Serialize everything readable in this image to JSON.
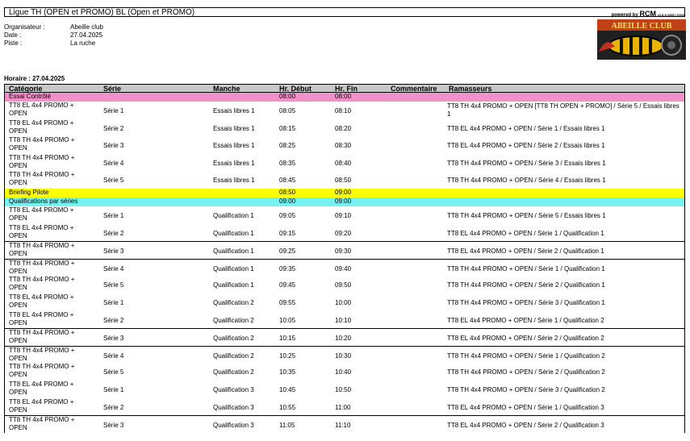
{
  "title": "Ligue TH (OPEN et PROMO) BL (Open et PROMO)",
  "powered": {
    "prefix": "powered by",
    "brand": "RCM",
    "version": "v2.8.5.1655 / 0204"
  },
  "meta": [
    {
      "key": "Organisateur :",
      "value": "Abeille club"
    },
    {
      "key": "Date :",
      "value": "27.04.2025"
    },
    {
      "key": "Piste :",
      "value": "La ruche"
    }
  ],
  "logo_text": "ABEILLE CLUB",
  "horaire": "Horaire : 27.04.2025",
  "columns": [
    "Catégorie",
    "Série",
    "Manche",
    "Hr. Début",
    "Hr. Fin",
    "Commentaire",
    "Ramasseurs"
  ],
  "colors": {
    "pink": "#f291c9",
    "yellow": "#ffff00",
    "cyan": "#77f2f0",
    "header": "#c8c8c8"
  },
  "rows": [
    {
      "kind": "band",
      "color": "pink",
      "cat": "Essai Contrôlé",
      "start": "08:00",
      "end": "08:00"
    },
    {
      "kind": "data",
      "cat": "TT8 EL 4x4 PROMO + OPEN",
      "serie": "Série 1",
      "manche": "Essais libres 1",
      "start": "08:05",
      "end": "08:10",
      "ram": "TT8 TH 4x4 PROMO + OPEN [TT8 TH OPEN + PROMO] / Série 5 / Essais libres 1",
      "wrap": true
    },
    {
      "kind": "data",
      "cat": "TT8 EL 4x4 PROMO + OPEN",
      "serie": "Série 2",
      "manche": "Essais libres 1",
      "start": "08:15",
      "end": "08:20",
      "ram": "TT8 EL 4x4 PROMO + OPEN / Série 1 / Essais libres 1"
    },
    {
      "kind": "data",
      "cat": "TT8 TH 4x4 PROMO + OPEN",
      "serie": "Série 3",
      "manche": "Essais libres 1",
      "start": "08:25",
      "end": "08:30",
      "ram": "TT8 EL 4x4 PROMO + OPEN / Série 2 / Essais libres 1"
    },
    {
      "kind": "data",
      "cat": "TT8 TH 4x4 PROMO + OPEN",
      "serie": "Série 4",
      "manche": "Essais libres 1",
      "start": "08:35",
      "end": "08:40",
      "ram": "TT8 TH 4x4 PROMO + OPEN / Série 3 / Essais libres 1"
    },
    {
      "kind": "data",
      "cat": "TT8 TH 4x4 PROMO + OPEN",
      "serie": "Série 5",
      "manche": "Essais libres 1",
      "start": "08:45",
      "end": "08:50",
      "ram": "TT8 TH 4x4 PROMO + OPEN / Série 4 / Essais libres 1"
    },
    {
      "kind": "band",
      "color": "yellow",
      "cat": "Briefing Pilote",
      "start": "08:50",
      "end": "09:00"
    },
    {
      "kind": "band",
      "color": "cyan",
      "cat": "Qualifications par séries",
      "start": "09:00",
      "end": "09:00"
    },
    {
      "kind": "data",
      "cat": "TT8 EL 4x4 PROMO + OPEN",
      "serie": "Série 1",
      "manche": "Qualification 1",
      "start": "09:05",
      "end": "09:10",
      "ram": "TT8 TH 4x4 PROMO + OPEN / Série 5 / Essais libres 1"
    },
    {
      "kind": "data",
      "cat": "TT8 EL 4x4 PROMO + OPEN",
      "serie": "Série 2",
      "manche": "Qualification 1",
      "start": "09:15",
      "end": "09:20",
      "ram": "TT8 EL 4x4 PROMO + OPEN / Série 1 / Qualification 1"
    },
    {
      "kind": "data",
      "cat": "TT8 TH 4x4 PROMO + OPEN",
      "serie": "Série 3",
      "manche": "Qualification 1",
      "start": "09:25",
      "end": "09:30",
      "ram": "TT8 EL 4x4 PROMO + OPEN / Série 2 / Qualification 1",
      "sep": true
    },
    {
      "kind": "data",
      "cat": "TT8 TH 4x4 PROMO + OPEN",
      "serie": "Série 4",
      "manche": "Qualification 1",
      "start": "09:35",
      "end": "09:40",
      "ram": "TT8 TH 4x4 PROMO + OPEN / Série 1 / Qualification 1",
      "sep": true
    },
    {
      "kind": "data",
      "cat": "TT8 TH 4x4 PROMO + OPEN",
      "serie": "Série 5",
      "manche": "Qualification 1",
      "start": "09:45",
      "end": "09:50",
      "ram": "TT8 TH 4x4 PROMO + OPEN / Série 2 / Qualification 1"
    },
    {
      "kind": "data",
      "cat": "TT8 EL 4x4 PROMO + OPEN",
      "serie": "Série 1",
      "manche": "Qualification 2",
      "start": "09:55",
      "end": "10:00",
      "ram": "TT8 TH 4x4 PROMO + OPEN / Série 3 / Qualification 1"
    },
    {
      "kind": "data",
      "cat": "TT8 EL 4x4 PROMO + OPEN",
      "serie": "Série 2",
      "manche": "Qualification 2",
      "start": "10:05",
      "end": "10:10",
      "ram": "TT8 EL 4x4 PROMO + OPEN / Série 1 / Qualification 2"
    },
    {
      "kind": "data",
      "cat": "TT8 TH 4x4 PROMO + OPEN",
      "serie": "Série 3",
      "manche": "Qualification 2",
      "start": "10:15",
      "end": "10:20",
      "ram": "TT8 EL 4x4 PROMO + OPEN / Série 2 / Qualification 2",
      "sep": true
    },
    {
      "kind": "data",
      "cat": "TT8 TH 4x4 PROMO + OPEN",
      "serie": "Série 4",
      "manche": "Qualification 2",
      "start": "10:25",
      "end": "10:30",
      "ram": "TT8 TH 4x4 PROMO + OPEN / Série 1 / Qualification 2",
      "sep": true
    },
    {
      "kind": "data",
      "cat": "TT8 TH 4x4 PROMO + OPEN",
      "serie": "Série 5",
      "manche": "Qualification 2",
      "start": "10:35",
      "end": "10:40",
      "ram": "TT8 TH 4x4 PROMO + OPEN / Série 2 / Qualification 2"
    },
    {
      "kind": "data",
      "cat": "TT8 EL 4x4 PROMO + OPEN",
      "serie": "Série 1",
      "manche": "Qualification 3",
      "start": "10:45",
      "end": "10:50",
      "ram": "TT8 TH 4x4 PROMO + OPEN / Série 3 / Qualification 2"
    },
    {
      "kind": "data",
      "cat": "TT8 EL 4x4 PROMO + OPEN",
      "serie": "Série 2",
      "manche": "Qualification 3",
      "start": "10:55",
      "end": "11:00",
      "ram": "TT8 EL 4x4 PROMO + OPEN / Série 1 / Qualification 3"
    },
    {
      "kind": "data",
      "cat": "TT8 TH 4x4 PROMO + OPEN",
      "serie": "Série 3",
      "manche": "Qualification 3",
      "start": "11:05",
      "end": "11:10",
      "ram": "TT8 EL 4x4 PROMO + OPEN / Série 2 / Qualification 3",
      "sep": true
    }
  ]
}
